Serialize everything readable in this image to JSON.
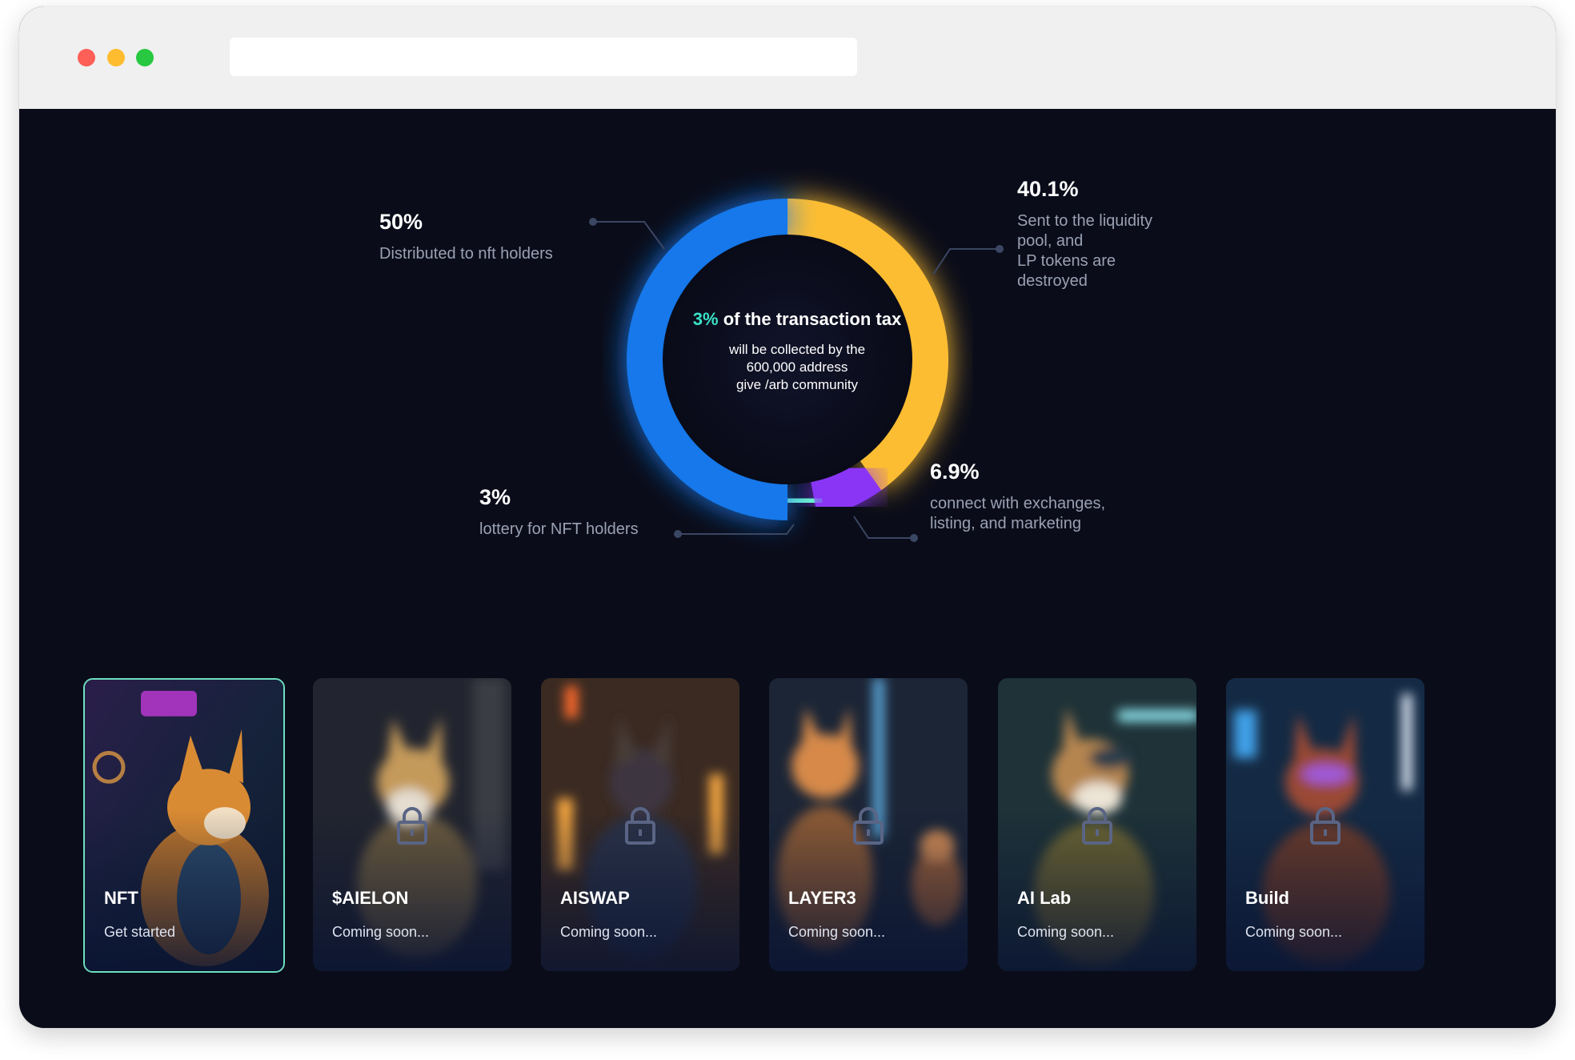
{
  "window": {
    "controls": [
      "close",
      "minimize",
      "maximize"
    ],
    "url": ""
  },
  "chart_data": {
    "type": "pie",
    "segments": [
      {
        "label": "50%",
        "value": 50,
        "description": "Distributed to nft holders",
        "color": "#1778ea"
      },
      {
        "label": "40.1%",
        "value": 40.1,
        "description": "Sent to the liquidity pool, and LP tokens are destroyed",
        "color": "#fdbd33"
      },
      {
        "label": "6.9%",
        "value": 6.9,
        "description": "connect with exchanges, listing, and marketing",
        "color": "#8a34f6"
      },
      {
        "label": "3%",
        "value": 3,
        "description": "lottery for NFT holders",
        "color": "#6ef0d0"
      }
    ],
    "center": {
      "accent": "3%",
      "headline": "of the transaction tax",
      "sub_line1": "will be collected by the",
      "sub_line2": "600,000 address",
      "sub_line3": "give /arb community"
    }
  },
  "labels": {
    "nft_holders": {
      "pct": "50%",
      "desc": "Distributed to nft holders"
    },
    "liquidity": {
      "pct": "40.1%",
      "line1": "Sent to the liquidity",
      "line2": "pool, and",
      "line3": "LP tokens are",
      "line4": "destroyed"
    },
    "marketing": {
      "pct": "6.9%",
      "line1": "connect with exchanges,",
      "line2": "listing, and marketing"
    },
    "lottery": {
      "pct": "3%",
      "desc": "lottery for NFT holders"
    }
  },
  "cards": [
    {
      "title": "NFT",
      "status": "Get started",
      "locked": false,
      "icon": "shiba-character",
      "accent": "#6de0c0"
    },
    {
      "title": "$AIELON",
      "status": "Coming soon...",
      "locked": true,
      "icon": "lock-icon"
    },
    {
      "title": "AISWAP",
      "status": "Coming soon...",
      "locked": true,
      "icon": "lock-icon"
    },
    {
      "title": "LAYER3",
      "status": "Coming soon...",
      "locked": true,
      "icon": "lock-icon"
    },
    {
      "title": "AI Lab",
      "status": "Coming soon...",
      "locked": true,
      "icon": "lock-icon"
    },
    {
      "title": "Build",
      "status": "Coming soon...",
      "locked": true,
      "icon": "lock-icon"
    }
  ]
}
